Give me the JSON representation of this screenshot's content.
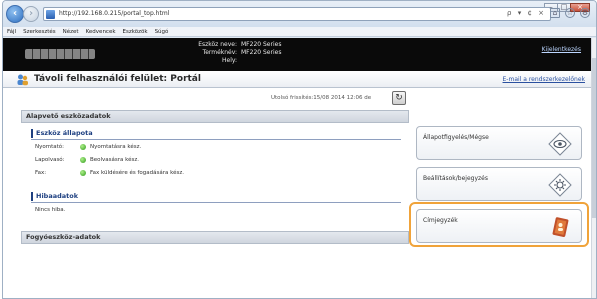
{
  "browser": {
    "url": "http://192.168.0.215/portal_top.html",
    "address_icons": "ρ ▾ ¢ ×",
    "menu": [
      "Fájl",
      "Szerkesztés",
      "Nézet",
      "Kedvencek",
      "Eszközök",
      "Súgó"
    ]
  },
  "header": {
    "device_name_label": "Eszköz neve:",
    "device_name_value": "MF220 Series",
    "product_name_label": "Terméknév:",
    "product_name_value": "MF220 Series",
    "location_label": "Hely:",
    "location_value": "",
    "logout": "Kijelentkezés"
  },
  "portal": {
    "title": "Távoli felhasználói felület: Portál",
    "mail_link": "E-mail a rendszerkezelőnek",
    "last_updated": "Utolsó frissítés:15/08 2014 12:06 de",
    "refresh_icon": "refresh-icon"
  },
  "main": {
    "basic_info_title": "Alapvető eszközadatok",
    "device_status_title": "Eszköz állapota",
    "status_rows": [
      {
        "label": "Nyomtató:",
        "value": "Nyomtatásra kész."
      },
      {
        "label": "Lapolvasó:",
        "value": "Beolvasásra kész."
      },
      {
        "label": "Fax:",
        "value": "Fax küldésére és fogadására kész."
      }
    ],
    "error_title": "Hibaadatok",
    "error_text": "Nincs hiba.",
    "consumables_title": "Fogyóeszköz-adatok"
  },
  "side_menu": [
    {
      "label": "Állapotfigyelés/Mégse",
      "icon": "monitor-eye-icon"
    },
    {
      "label": "Beállítások/bejegyzés",
      "icon": "settings-gear-icon"
    },
    {
      "label": "Címjegyzék",
      "icon": "address-book-icon"
    }
  ],
  "colors": {
    "accent": "#f0a33a",
    "link": "#2a50a0",
    "status_ok": "#2f9a1c"
  }
}
